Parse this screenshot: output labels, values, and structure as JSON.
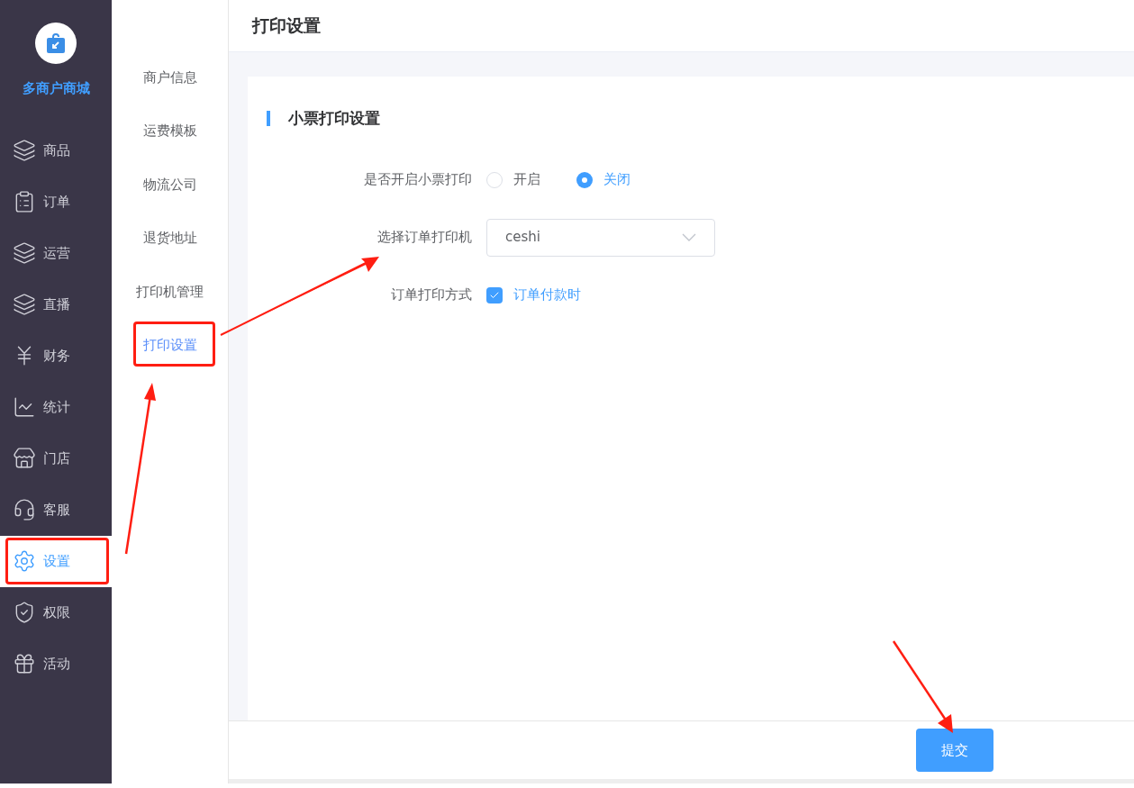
{
  "brand": {
    "name": "多商户商城"
  },
  "nav": [
    {
      "label": "商品",
      "selected": false
    },
    {
      "label": "订单",
      "selected": false
    },
    {
      "label": "运营",
      "selected": false
    },
    {
      "label": "直播",
      "selected": false
    },
    {
      "label": "财务",
      "selected": false
    },
    {
      "label": "统计",
      "selected": false
    },
    {
      "label": "门店",
      "selected": false
    },
    {
      "label": "客服",
      "selected": false
    },
    {
      "label": "设置",
      "selected": true
    },
    {
      "label": "权限",
      "selected": false
    },
    {
      "label": "活动",
      "selected": false
    }
  ],
  "submenu": [
    {
      "label": "商户信息",
      "selected": false
    },
    {
      "label": "运费模板",
      "selected": false
    },
    {
      "label": "物流公司",
      "selected": false
    },
    {
      "label": "退货地址",
      "selected": false
    },
    {
      "label": "打印机管理",
      "selected": false
    },
    {
      "label": "打印设置",
      "selected": true
    }
  ],
  "page_title": "打印设置",
  "section_title": "小票打印设置",
  "form": [
    {
      "kind": "radio",
      "label": "是否开启小票打印",
      "options": [
        {
          "label": "开启",
          "selected": false
        },
        {
          "label": "关闭",
          "selected": true
        }
      ]
    },
    {
      "kind": "select",
      "label": "选择订单打印机",
      "value": "ceshi"
    },
    {
      "kind": "checkbox",
      "label": "订单打印方式",
      "options": [
        {
          "label": "订单付款时",
          "checked": true
        }
      ]
    }
  ],
  "submit": "提交"
}
